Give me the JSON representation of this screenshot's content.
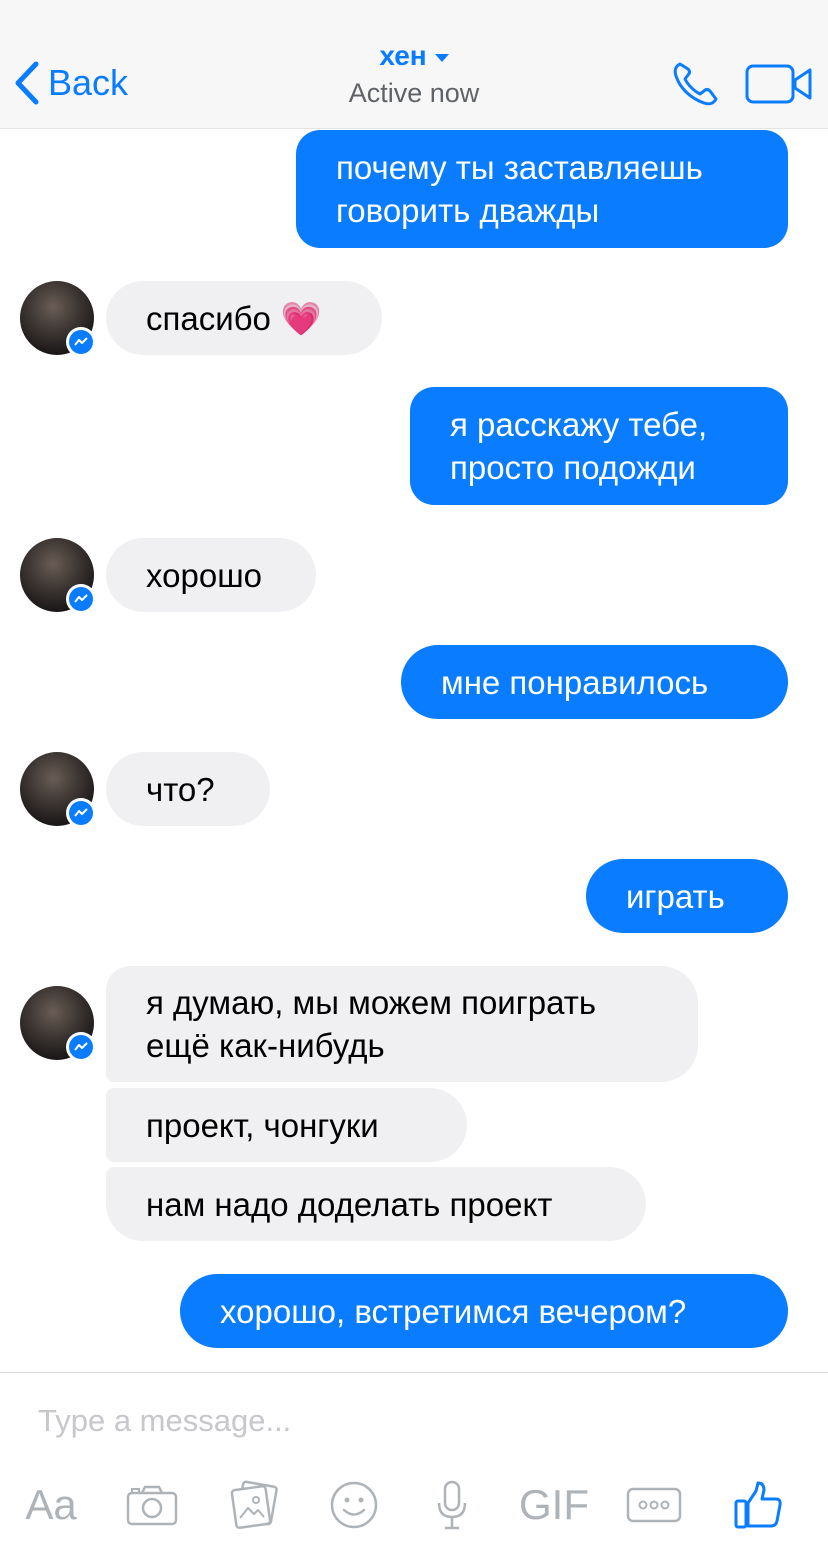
{
  "header": {
    "back_label": "Back",
    "contact_name": "хен",
    "status": "Active now",
    "icons": [
      "chevron-left-icon",
      "caret-down-icon",
      "phone-icon",
      "video-camera-icon"
    ]
  },
  "messages": [
    {
      "side": "outgoing",
      "text": "почему ты заставляешь\nговорить дважды"
    },
    {
      "side": "incoming",
      "text": "спасибо",
      "emoji": "💗"
    },
    {
      "side": "outgoing",
      "text": "я расскажу тебе,\nпросто подожди"
    },
    {
      "side": "incoming",
      "text": "хорошо"
    },
    {
      "side": "outgoing",
      "text": "мне понравилось"
    },
    {
      "side": "incoming",
      "text": "что?"
    },
    {
      "side": "outgoing",
      "text": "играть"
    },
    {
      "side": "incoming",
      "text": "я думаю, мы можем поиграть\nещё как-нибудь"
    },
    {
      "side": "incoming",
      "text": "проект, чонгуки"
    },
    {
      "side": "incoming",
      "text": "нам надо доделать проект"
    },
    {
      "side": "outgoing",
      "text": "хорошо, встретимся вечером?"
    }
  ],
  "composer": {
    "placeholder": "Type a message...",
    "text_button_label": "Aa",
    "gif_button_label": "GIF",
    "icons": [
      "camera-icon",
      "gallery-icon",
      "emoji-icon",
      "microphone-icon",
      "more-icon",
      "thumbs-up-icon"
    ]
  },
  "colors": {
    "accent": "#0a7cff",
    "incoming_bubble": "#f0f0f2",
    "header_bg": "#f7f7f7",
    "toolbar_icon": "#aeb3b8"
  }
}
